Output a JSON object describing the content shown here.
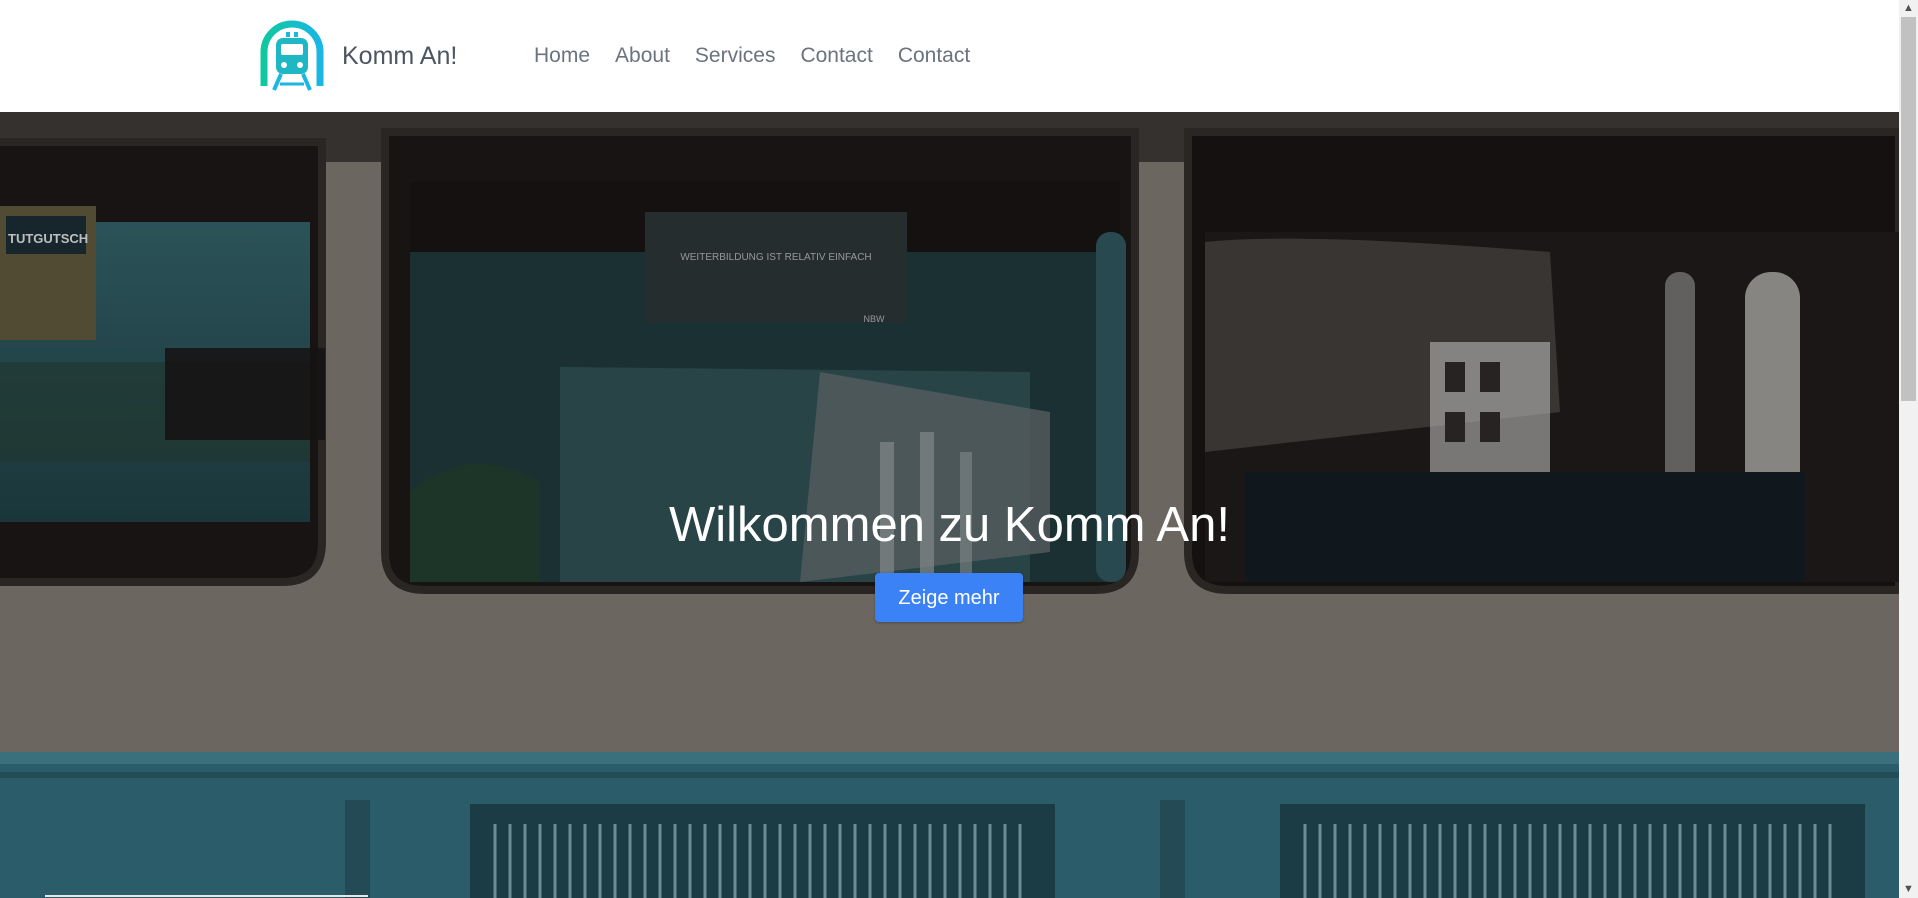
{
  "brand": {
    "name": "Komm An!",
    "logo_icon": "train-icon",
    "logo_colors": [
      "#10c8a0",
      "#19b6e6"
    ]
  },
  "nav": {
    "items": [
      {
        "label": "Home"
      },
      {
        "label": "About"
      },
      {
        "label": "Services"
      },
      {
        "label": "Contact"
      },
      {
        "label": "Contact"
      }
    ]
  },
  "hero": {
    "title": "Wilkommen zu Komm An!",
    "button_label": "Zeige mehr",
    "background_image": "train-car-windows",
    "window_sign_text": "WEITERBILDUNG IST RELATIV EINFACH",
    "window_sign_small": "NBW",
    "sticker_text": "TUTGUTSCH"
  },
  "colors": {
    "accent": "#3b82f6",
    "nav_text": "#6b7280",
    "brand_text": "#4b5563"
  },
  "scrollbar": {
    "up_icon": "scroll-up-arrow-icon",
    "down_icon": "scroll-down-arrow-icon"
  }
}
